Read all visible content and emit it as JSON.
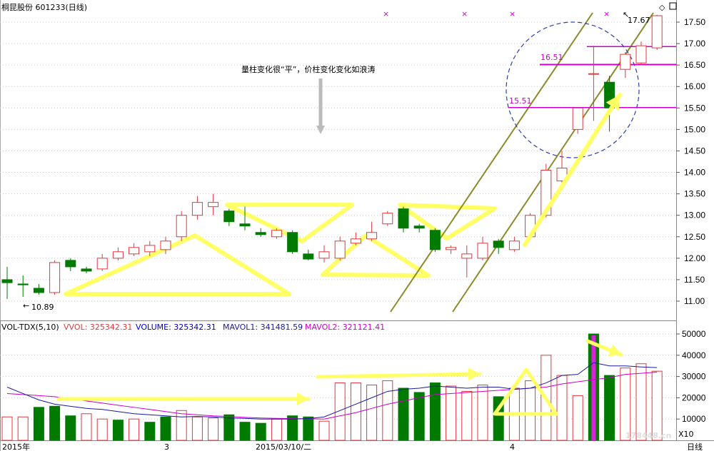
{
  "header": {
    "title": "桐昆股份 601233(日线)",
    "corner_icons": [
      "diamond-icon",
      "restore-icon"
    ]
  },
  "annotations": {
    "main_text": "量柱变化很“平”，价柱变化变化如浪涛",
    "high_marker": "17.67",
    "low_marker": "10.89",
    "level_high": "16.51",
    "level_low": "15.51"
  },
  "volume_header": {
    "indicator": "VOL-TDX(5,10)",
    "vvol": "VVOL: 325342.31",
    "volume": "VOLUME: 325342.31",
    "mavol1": "MAVOL1: 341481.59",
    "mavol2": "MAVOL2: 321121.41"
  },
  "x_axis": {
    "labels": [
      "2015年",
      "3",
      "2015/03/10/二",
      "4"
    ],
    "period": "日线"
  },
  "watermark": "178448.cn",
  "volume_unit": "X10",
  "colors": {
    "up": "#e0393e",
    "down": "#007a00",
    "vvol": "#e0393e",
    "volume": "#0000cc",
    "mavol1": "#1a1aa0",
    "mavol2": "#cc00cc",
    "trend": "#8b8b2b",
    "highlight": "#ffff66",
    "level_line": "#cc00cc"
  },
  "chart_data": [
    {
      "type": "candlestick",
      "title": "桐昆股份 601233(日线)",
      "ylim": [
        10.7,
        17.85
      ],
      "y_ticks": [
        "11.00",
        "11.50",
        "12.00",
        "12.50",
        "13.00",
        "13.50",
        "14.00",
        "14.50",
        "15.00",
        "15.50",
        "16.00",
        "16.50",
        "17.00",
        "17.50"
      ],
      "candles": [
        {
          "o": 11.5,
          "h": 11.8,
          "l": 11.05,
          "c": 11.43
        },
        {
          "o": 11.4,
          "h": 11.6,
          "l": 11.1,
          "c": 11.38
        },
        {
          "o": 11.3,
          "h": 11.4,
          "l": 11.15,
          "c": 11.2
        },
        {
          "o": 11.2,
          "h": 11.95,
          "l": 11.15,
          "c": 11.9
        },
        {
          "o": 11.95,
          "h": 12.0,
          "l": 11.7,
          "c": 11.8
        },
        {
          "o": 11.75,
          "h": 11.8,
          "l": 11.65,
          "c": 11.7
        },
        {
          "o": 11.75,
          "h": 12.1,
          "l": 11.7,
          "c": 12.0
        },
        {
          "o": 12.0,
          "h": 12.25,
          "l": 11.95,
          "c": 12.15
        },
        {
          "o": 12.1,
          "h": 12.35,
          "l": 12.05,
          "c": 12.25
        },
        {
          "o": 12.15,
          "h": 12.4,
          "l": 12.05,
          "c": 12.3
        },
        {
          "o": 12.2,
          "h": 12.5,
          "l": 12.1,
          "c": 12.4
        },
        {
          "o": 12.5,
          "h": 13.1,
          "l": 12.4,
          "c": 13.0
        },
        {
          "o": 13.0,
          "h": 13.45,
          "l": 12.9,
          "c": 13.3
        },
        {
          "o": 13.2,
          "h": 13.5,
          "l": 13.0,
          "c": 13.3
        },
        {
          "o": 13.1,
          "h": 13.15,
          "l": 12.75,
          "c": 12.85
        },
        {
          "o": 12.8,
          "h": 13.2,
          "l": 12.65,
          "c": 12.75
        },
        {
          "o": 12.6,
          "h": 12.7,
          "l": 12.5,
          "c": 12.55
        },
        {
          "o": 12.5,
          "h": 12.7,
          "l": 12.45,
          "c": 12.65
        },
        {
          "o": 12.6,
          "h": 12.65,
          "l": 12.1,
          "c": 12.15
        },
        {
          "o": 12.1,
          "h": 12.2,
          "l": 11.95,
          "c": 11.98
        },
        {
          "o": 12.0,
          "h": 12.3,
          "l": 11.9,
          "c": 12.15
        },
        {
          "o": 12.0,
          "h": 12.5,
          "l": 11.95,
          "c": 12.4
        },
        {
          "o": 12.35,
          "h": 12.6,
          "l": 12.3,
          "c": 12.45
        },
        {
          "o": 12.45,
          "h": 12.85,
          "l": 12.4,
          "c": 12.6
        },
        {
          "o": 12.8,
          "h": 13.1,
          "l": 12.75,
          "c": 13.05
        },
        {
          "o": 13.15,
          "h": 13.2,
          "l": 12.6,
          "c": 12.7
        },
        {
          "o": 12.75,
          "h": 12.8,
          "l": 12.6,
          "c": 12.7
        },
        {
          "o": 12.65,
          "h": 12.7,
          "l": 12.15,
          "c": 12.2
        },
        {
          "o": 12.2,
          "h": 12.3,
          "l": 12.1,
          "c": 12.25
        },
        {
          "o": 12.0,
          "h": 12.3,
          "l": 11.55,
          "c": 12.1
        },
        {
          "o": 12.0,
          "h": 12.5,
          "l": 11.95,
          "c": 12.35
        },
        {
          "o": 12.4,
          "h": 12.45,
          "l": 12.1,
          "c": 12.25
        },
        {
          "o": 12.2,
          "h": 12.5,
          "l": 12.15,
          "c": 12.4
        },
        {
          "o": 12.5,
          "h": 13.05,
          "l": 12.45,
          "c": 13.0
        },
        {
          "o": 13.0,
          "h": 14.2,
          "l": 12.95,
          "c": 14.05
        },
        {
          "o": 13.8,
          "h": 14.5,
          "l": 13.6,
          "c": 14.1
        },
        {
          "o": 15.0,
          "h": 15.5,
          "l": 14.9,
          "c": 15.5
        },
        {
          "o": 16.3,
          "h": 16.95,
          "l": 15.2,
          "c": 16.3
        },
        {
          "o": 16.1,
          "h": 16.25,
          "l": 14.95,
          "c": 15.5
        },
        {
          "o": 16.4,
          "h": 16.8,
          "l": 16.2,
          "c": 16.75
        },
        {
          "o": 16.55,
          "h": 17.05,
          "l": 16.5,
          "c": 16.95
        },
        {
          "o": 16.9,
          "h": 17.67,
          "l": 16.85,
          "c": 17.65
        }
      ]
    },
    {
      "type": "bar",
      "title": "VOL-TDX(5,10)",
      "ylim": [
        0,
        52000
      ],
      "y_ticks": [
        "10000",
        "20000",
        "30000",
        "40000",
        "50000"
      ],
      "values": [
        11000,
        11000,
        15500,
        16000,
        11500,
        12500,
        10000,
        9500,
        10000,
        8500,
        11000,
        14000,
        11000,
        10500,
        12000,
        8500,
        8000,
        10000,
        11500,
        11000,
        9000,
        27000,
        27000,
        26000,
        28000,
        24500,
        22500,
        27000,
        25500,
        23000,
        26000,
        20500,
        24500,
        28000,
        40000,
        30500,
        21000,
        50000,
        30500,
        34000,
        36000,
        32500
      ],
      "down": [
        false,
        false,
        true,
        true,
        true,
        false,
        false,
        true,
        false,
        true,
        true,
        false,
        false,
        false,
        true,
        true,
        true,
        false,
        true,
        true,
        false,
        false,
        false,
        false,
        false,
        true,
        true,
        true,
        false,
        false,
        false,
        true,
        false,
        false,
        false,
        false,
        false,
        false,
        true,
        false,
        false,
        false
      ],
      "highlight_index": 37,
      "mavol1": [
        25000,
        22000,
        19000,
        17000,
        16000,
        15000,
        14500,
        13500,
        12500,
        12000,
        11500,
        11000,
        11200,
        11000,
        10500,
        10300,
        10000,
        10000,
        10000,
        10200,
        11000,
        14000,
        17000,
        20000,
        23000,
        24000,
        24500,
        25500,
        25000,
        24500,
        25000,
        25000,
        24000,
        24500,
        27000,
        30500,
        31000,
        36500,
        35000,
        35000,
        34500,
        34200
      ],
      "mavol2": [
        22000,
        21500,
        21000,
        20500,
        19500,
        18500,
        17500,
        16500,
        15500,
        14500,
        13500,
        12500,
        12000,
        11500,
        11200,
        10800,
        10500,
        10300,
        10200,
        10100,
        10000,
        11500,
        13000,
        15000,
        17000,
        18500,
        20000,
        21500,
        22000,
        22500,
        23000,
        23500,
        24000,
        24500,
        25000,
        26500,
        27500,
        28500,
        29500,
        31000,
        31500,
        32100
      ],
      "series_names": [
        "VVOL",
        "VOLUME",
        "MAVOL1",
        "MAVOL2"
      ]
    }
  ]
}
